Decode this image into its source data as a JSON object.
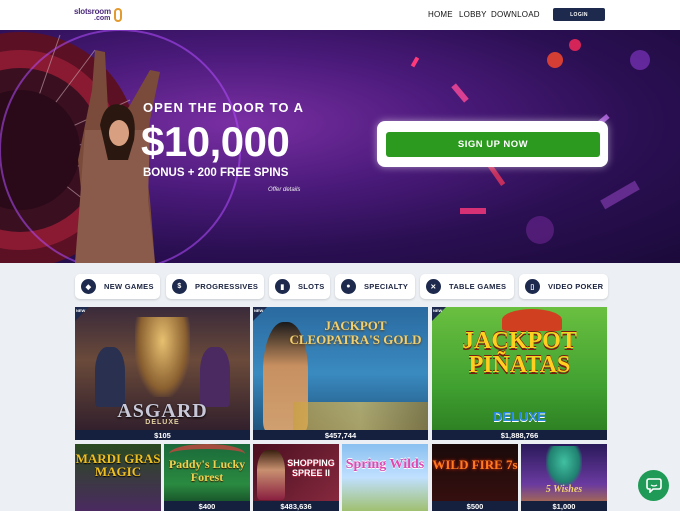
{
  "header": {
    "logo_line1": "slotsroom",
    "logo_line2": ".com",
    "nav": [
      "HOME",
      "LOBBY",
      "DOWNLOAD"
    ],
    "login_label": "LOGIN"
  },
  "hero": {
    "line1": "OPEN THE DOOR TO A",
    "amount": "$10,000",
    "line2": "BONUS + 200 FREE SPINS",
    "offer_details": "Offer details",
    "cta_label": "SIGN UP NOW"
  },
  "categories": [
    {
      "label": "NEW GAMES",
      "icon": "diamond-icon"
    },
    {
      "label": "PROGRESSIVES",
      "icon": "progressive-icon"
    },
    {
      "label": "SLOTS",
      "icon": "slot-icon"
    },
    {
      "label": "SPECIALTY",
      "icon": "specialty-icon"
    },
    {
      "label": "TABLE GAMES",
      "icon": "table-games-icon"
    },
    {
      "label": "VIDEO POKER",
      "icon": "cards-icon"
    }
  ],
  "games_large": [
    {
      "title": "ASGARD",
      "subtitle": "DELUXE",
      "jackpot": "$105",
      "badge": "NEW"
    },
    {
      "title": "JACKPOT CLEOPATRA'S GOLD",
      "subtitle": "",
      "jackpot": "$457,744",
      "badge": "NEW"
    },
    {
      "title": "JACKPOT PIÑATAS",
      "subtitle": "DELUXE",
      "jackpot": "$1,888,766",
      "badge": "NEW"
    }
  ],
  "games_small": [
    {
      "title": "MARDI GRAS MAGIC",
      "jackpot": ""
    },
    {
      "title": "Paddy's Lucky Forest",
      "jackpot": "$400"
    },
    {
      "title": "SHOPPING SPREE II",
      "jackpot": "$483,636"
    },
    {
      "title": "Spring Wilds",
      "jackpot": ""
    },
    {
      "title": "WILD FIRE 7s",
      "jackpot": "$500"
    },
    {
      "title": "5 Wishes",
      "jackpot": "$1,000"
    }
  ],
  "colors": {
    "navy": "#1d2a4d",
    "cta_green": "#2c9a1e",
    "chat_green": "#1f9b57"
  }
}
